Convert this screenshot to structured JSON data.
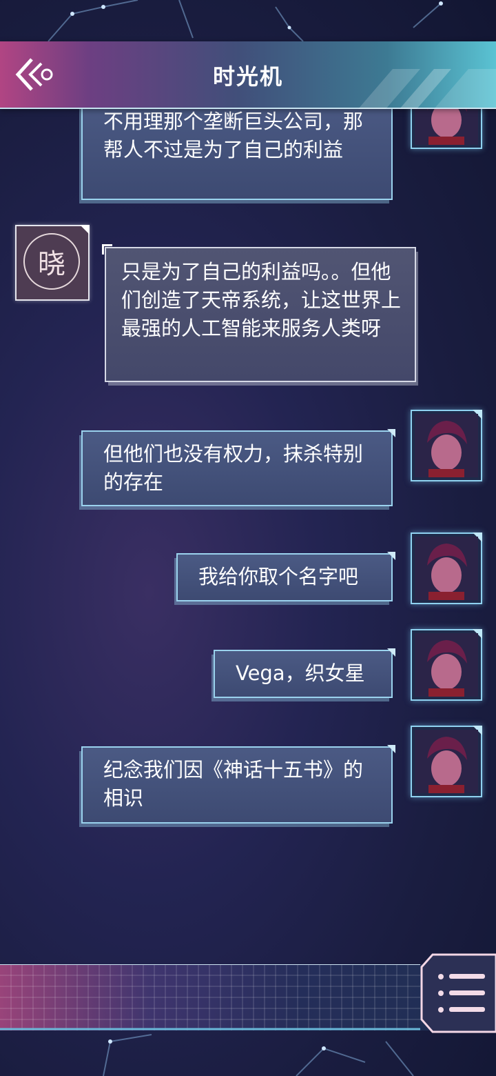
{
  "header": {
    "title": "时光机",
    "back_icon": "double-chevron-left-icon"
  },
  "messages": [
    {
      "side": "right",
      "text": "不用理那个垄断巨头公司，那帮人不过是为了自己的利益"
    },
    {
      "side": "left",
      "avatar_glyph": "晓",
      "text": "只是为了自己的利益吗。。但他们创造了天帝系统，让这世界上最强的人工智能来服务人类呀"
    },
    {
      "side": "right",
      "text": "但他们也没有权力，抹杀特别的存在"
    },
    {
      "side": "right",
      "text": "我给你取个名字吧"
    },
    {
      "side": "right",
      "text": "Vega，织女星"
    },
    {
      "side": "right",
      "text": "纪念我们因《神话十五书》的相识"
    }
  ],
  "bottom": {
    "menu_icon": "menu-list-icon"
  },
  "colors": {
    "header_left": "#b14583",
    "header_right": "#5ac3d3",
    "bubble_border": "#9bd3ee",
    "background": "#1a1d40"
  }
}
